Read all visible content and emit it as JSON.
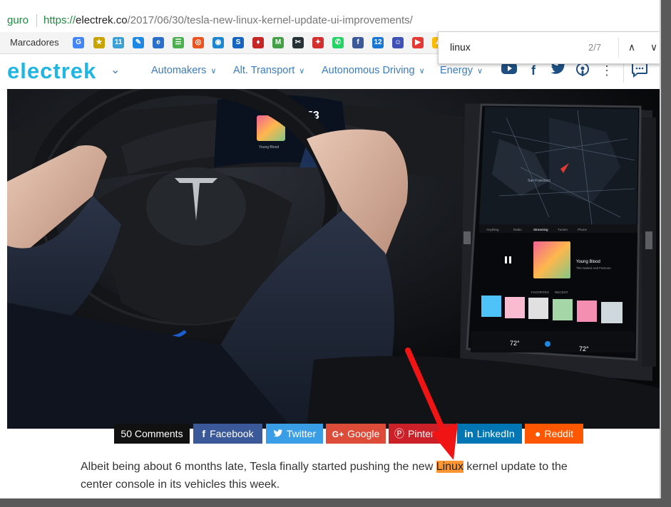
{
  "urlbar": {
    "secure_label": "guro",
    "url_scheme": "https://",
    "url_domain": "electrek.co",
    "url_path": "/2017/06/30/tesla-new-linux-kernel-update-ui-improvements/"
  },
  "bookmarks": {
    "label": "Marcadores",
    "icons": [
      {
        "name": "google-icon",
        "glyph": "G",
        "color": "#4285f4"
      },
      {
        "name": "yellow-figure-icon",
        "glyph": "★",
        "color": "#c9a400"
      },
      {
        "name": "calendar-icon",
        "glyph": "11",
        "color": "#3aa0d6"
      },
      {
        "name": "blue-pen-icon",
        "glyph": "✎",
        "color": "#1e88e5"
      },
      {
        "name": "blue-e-icon",
        "glyph": "e",
        "color": "#2a6fc9"
      },
      {
        "name": "android-icon",
        "glyph": "☰",
        "color": "#4caf50"
      },
      {
        "name": "ubuntu-icon",
        "glyph": "◎",
        "color": "#e95420"
      },
      {
        "name": "blue-circle-icon",
        "glyph": "◉",
        "color": "#1c86d1"
      },
      {
        "name": "swirl-icon",
        "glyph": "S",
        "color": "#1565c0"
      },
      {
        "name": "red-app-icon",
        "glyph": "♦",
        "color": "#c62828"
      },
      {
        "name": "green-m-icon",
        "glyph": "M",
        "color": "#43a047"
      },
      {
        "name": "scissors-icon",
        "glyph": "✂",
        "color": "#263238"
      },
      {
        "name": "red-square-icon",
        "glyph": "✦",
        "color": "#d32f2f"
      },
      {
        "name": "whatsapp-icon",
        "glyph": "✆",
        "color": "#25d366"
      },
      {
        "name": "facebook-bookmark-icon",
        "glyph": "f",
        "color": "#3b5998"
      },
      {
        "name": "calendar-12-icon",
        "glyph": "12",
        "color": "#1976d2"
      },
      {
        "name": "contacts-icon",
        "glyph": "☺",
        "color": "#3f51b5"
      },
      {
        "name": "youtube-icon",
        "glyph": "▶",
        "color": "#e53935"
      },
      {
        "name": "drive-icon",
        "glyph": "▲",
        "color": "#fbbc04"
      }
    ]
  },
  "findbar": {
    "query": "linux",
    "count": "2/7",
    "prev_icon": "chevron-up-icon",
    "next_icon": "chevron-down-icon"
  },
  "site": {
    "logo": "electrek",
    "nav": [
      "Automakers",
      "Alt. Transport",
      "Autonomous Driving",
      "Energy"
    ],
    "social_icons": [
      "youtube-icon",
      "facebook-icon",
      "twitter-icon",
      "podcast-icon",
      "more-vertical-icon",
      "comments-icon"
    ]
  },
  "hero": {
    "speed": "53",
    "song_title": "Young Blood",
    "song_artist": "The Naked And Famous",
    "tabs": [
      "Anything",
      "Radio",
      "Streaming",
      "TuneIn",
      "Phone"
    ],
    "section_favorites": "FAVORITES",
    "section_recent": "RECENT",
    "temp_left": "72°",
    "temp_right": "72°",
    "map_label": "San Francisco"
  },
  "share": [
    {
      "label": "50 Comments",
      "icon": "",
      "color": "#111111"
    },
    {
      "label": "Facebook",
      "icon": "f",
      "color": "#3b5998"
    },
    {
      "label": "Twitter",
      "icon": "❦",
      "color": "#3a9ee6"
    },
    {
      "label": "Google",
      "icon": "G+",
      "color": "#dd4b39"
    },
    {
      "label": "Pinterest",
      "icon": "Ⓟ",
      "color": "#cb2027"
    },
    {
      "label": "LinkedIn",
      "icon": "in",
      "color": "#0077b5"
    },
    {
      "label": "Reddit",
      "icon": "●",
      "color": "#ff5700"
    }
  ],
  "article": {
    "before": "Albeit being about 6 months late, Tesla finally started pushing the new ",
    "highlight": "Linux",
    "after": " kernel update to the center console in its vehicles this week."
  }
}
